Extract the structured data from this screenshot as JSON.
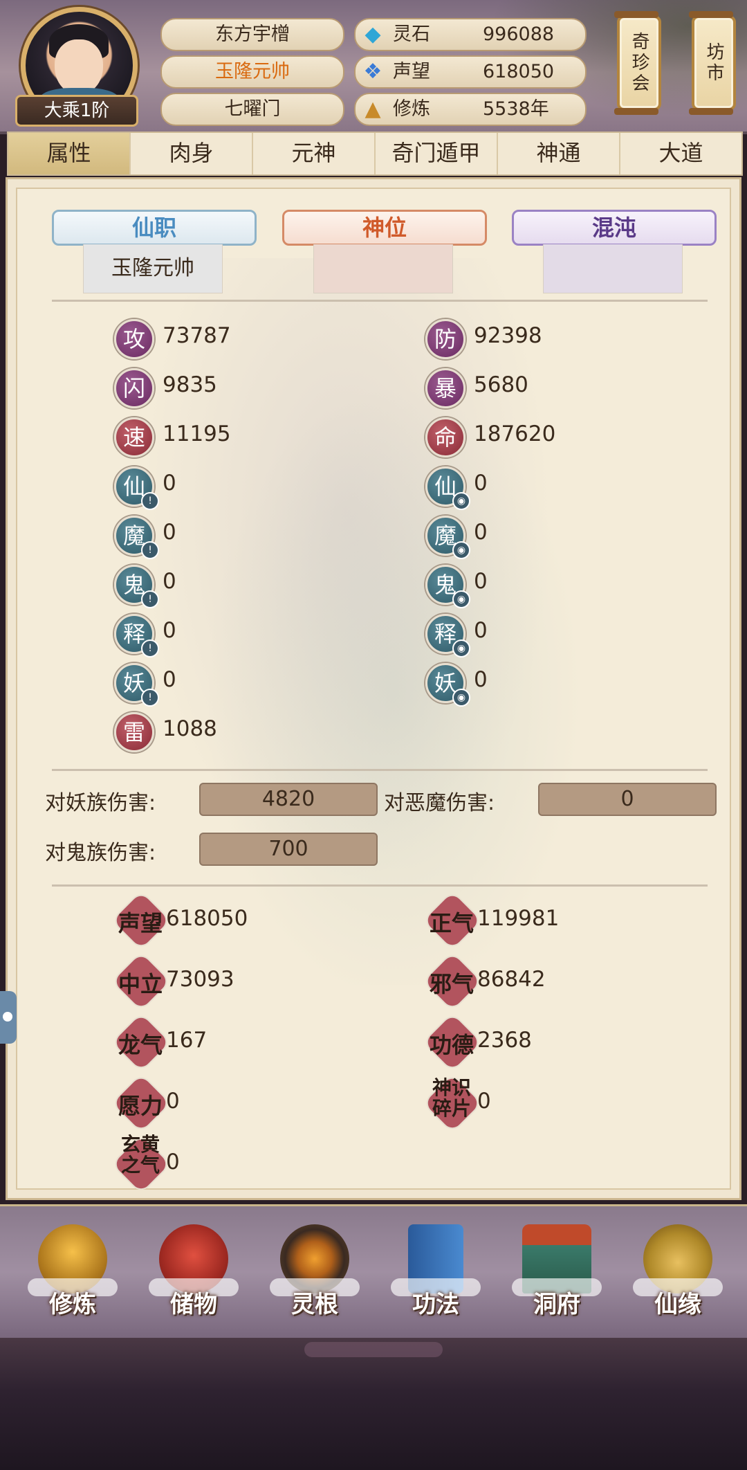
{
  "header": {
    "rank": "大乘1阶",
    "name_pills": [
      "东方宇橧",
      "玉隆元帅",
      "七曜门"
    ],
    "resources": [
      {
        "label": "灵石",
        "value": "996088",
        "icon": "gem-icon"
      },
      {
        "label": "声望",
        "value": "618050",
        "icon": "reputation-icon"
      },
      {
        "label": "修炼",
        "value": "5538年",
        "icon": "cultivation-icon"
      }
    ],
    "side_buttons": [
      "奇珍会",
      "坊市"
    ]
  },
  "tabs": [
    "属性",
    "肉身",
    "元神",
    "奇门遁甲",
    "神通",
    "大道"
  ],
  "active_tab": "属性",
  "titles": {
    "xianzhi": {
      "label": "仙职",
      "value": "玉隆元帅"
    },
    "shenwei": {
      "label": "神位",
      "value": ""
    },
    "hundun": {
      "label": "混沌",
      "value": ""
    }
  },
  "stats": {
    "left": [
      {
        "char": "攻",
        "value": "73787",
        "color": "purple"
      },
      {
        "char": "闪",
        "value": "9835",
        "color": "purple"
      },
      {
        "char": "速",
        "value": "11195",
        "color": "red"
      },
      {
        "char": "仙",
        "value": "0",
        "color": "teal"
      },
      {
        "char": "魔",
        "value": "0",
        "color": "teal"
      },
      {
        "char": "鬼",
        "value": "0",
        "color": "teal"
      },
      {
        "char": "释",
        "value": "0",
        "color": "teal"
      },
      {
        "char": "妖",
        "value": "0",
        "color": "teal"
      },
      {
        "char": "雷",
        "value": "1088",
        "color": "red"
      }
    ],
    "right": [
      {
        "char": "防",
        "value": "92398",
        "color": "purple"
      },
      {
        "char": "暴",
        "value": "5680",
        "color": "purple"
      },
      {
        "char": "命",
        "value": "187620",
        "color": "red"
      },
      {
        "char": "仙",
        "value": "0",
        "color": "teal"
      },
      {
        "char": "魔",
        "value": "0",
        "color": "teal"
      },
      {
        "char": "鬼",
        "value": "0",
        "color": "teal"
      },
      {
        "char": "释",
        "value": "0",
        "color": "teal"
      },
      {
        "char": "妖",
        "value": "0",
        "color": "teal"
      }
    ]
  },
  "damage": [
    {
      "label": "对妖族伤害:",
      "value": "4820"
    },
    {
      "label": "对恶魔伤害:",
      "value": "0"
    },
    {
      "label": "对鬼族伤害:",
      "value": "700"
    }
  ],
  "reputation": {
    "left": [
      {
        "label": "声望",
        "value": "618050"
      },
      {
        "label": "中立",
        "value": "73093"
      },
      {
        "label": "龙气",
        "value": "167"
      },
      {
        "label": "愿力",
        "value": "0"
      },
      {
        "label": "玄黄之气",
        "value": "0"
      }
    ],
    "right": [
      {
        "label": "正气",
        "value": "119981"
      },
      {
        "label": "邪气",
        "value": "86842"
      },
      {
        "label": "功德",
        "value": "2368"
      },
      {
        "label": "神识碎片",
        "value": "0"
      }
    ]
  },
  "bottom_nav": [
    {
      "label": "修炼",
      "icon": "cultivate-icon"
    },
    {
      "label": "储物",
      "icon": "storage-bag-icon"
    },
    {
      "label": "灵根",
      "icon": "spirit-root-icon"
    },
    {
      "label": "功法",
      "icon": "scripture-book-icon"
    },
    {
      "label": "洞府",
      "icon": "cave-dwelling-icon"
    },
    {
      "label": "仙缘",
      "icon": "gourd-icon"
    }
  ],
  "colors": {
    "accent": "#d9b06a",
    "stat_purple": "#6a2a62",
    "stat_teal": "#2e5a68",
    "stat_red": "#8a2a36",
    "rep_badge": "#b2545e"
  }
}
